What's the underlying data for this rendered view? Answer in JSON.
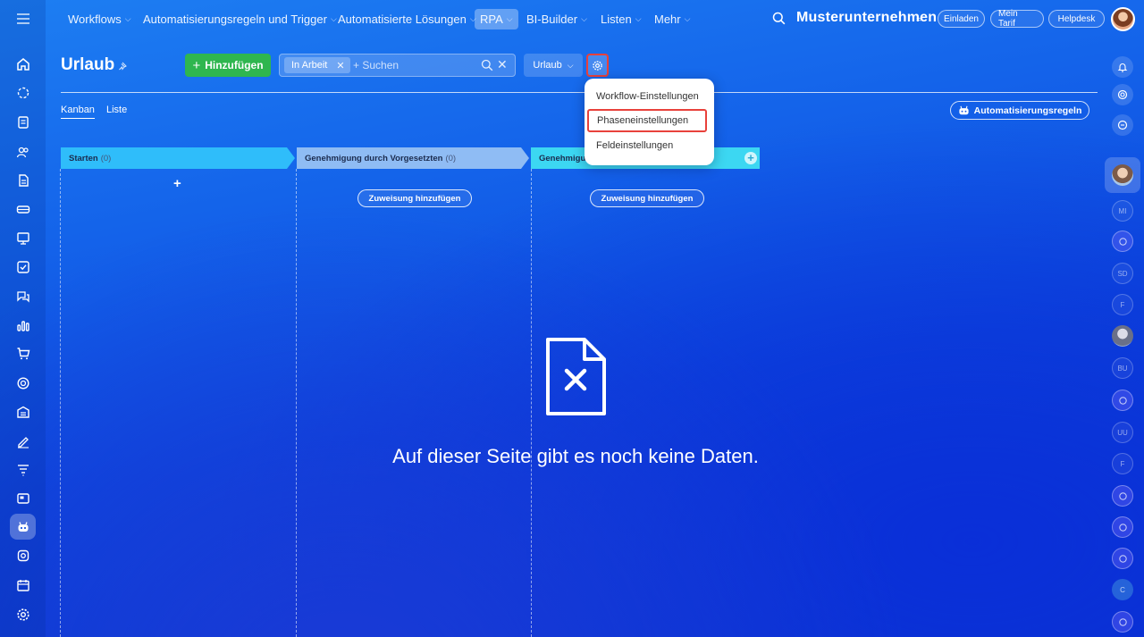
{
  "nav": {
    "items": [
      {
        "label": "Workflows",
        "chevron": true
      },
      {
        "label": "Automatisierungsregeln und Trigger",
        "chevron": true
      },
      {
        "label": "Automatisierte Lösungen",
        "chevron": true
      },
      {
        "label": "RPA",
        "chevron": true,
        "active": true
      },
      {
        "label": "BI-Builder",
        "chevron": true
      },
      {
        "label": "Listen",
        "chevron": true
      },
      {
        "label": "Mehr",
        "chevron": true
      }
    ],
    "company": "Musterunternehmen",
    "invite": "Einladen",
    "tariff": "Mein Tarif",
    "helpdesk": "Helpdesk"
  },
  "header": {
    "title": "Urlaub",
    "add_label": "Hinzufügen",
    "filter_chip": "In Arbeit",
    "search_placeholder": "+ Suchen",
    "view_select": "Urlaub"
  },
  "tabs": [
    "Kanban",
    "Liste"
  ],
  "automation_button": "Automatisierungsregeln",
  "stages": [
    {
      "name": "Starten",
      "count": "(0)",
      "color": "#2fbdfa"
    },
    {
      "name": "Genehmigung durch Vorgesetzten",
      "count": "(0)",
      "color": "#8fbcf4"
    },
    {
      "name": "Genehmigu",
      "count": "",
      "color": "#3cd7f2"
    }
  ],
  "assign_label": "Zuweisung hinzufügen",
  "empty_message": "Auf dieser Seite gibt es noch keine Daten.",
  "menu": {
    "items": [
      "Workflow-Einstellungen",
      "Phaseneinstellungen",
      "Feldeinstellungen"
    ],
    "selected": "Phaseneinstellungen"
  },
  "right_avatars": [
    "MI",
    "SD",
    "F",
    "BU",
    "UU",
    "F",
    "C"
  ],
  "colors": {
    "accent_green": "#2fb64f",
    "highlight_red": "#e8413b"
  }
}
